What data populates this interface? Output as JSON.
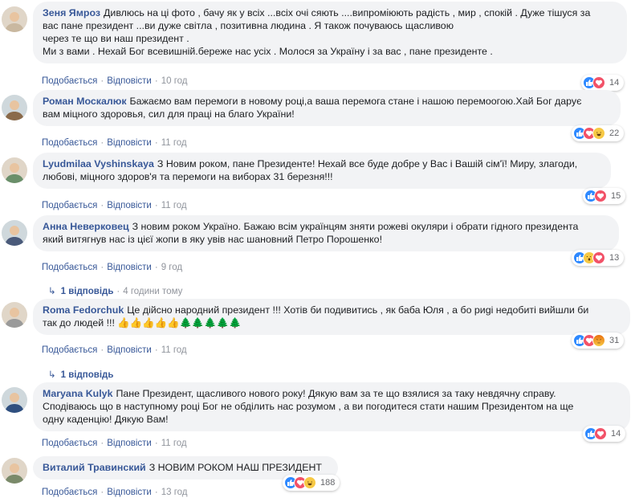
{
  "actions": {
    "like": "Подобається",
    "reply": "Відповісти",
    "separator": "·"
  },
  "comments": [
    {
      "author": "Зеня Ямроз",
      "lines": [
        "Дивлюсь на ці фото , бачу як у всіх ...всіх очі сяють ....випромiюють радість , мир , спокій . Дуже тішуся за",
        "вас пане президент ...ви дуже світла , позитивна людина . Я також почуваюсь щасливою",
        "через те що ви наш президент .",
        "Ми з вами . Нехай Бог всевишній.береже нас усіх . Молося за Україну і за вас , пане президенте ."
      ],
      "time": "10 год",
      "reactions": [
        "like",
        "love"
      ],
      "reaction_count": "14",
      "avatar_color": "#c9b8a0"
    },
    {
      "author": "Роман Москалюк",
      "lines": [
        "Бажаємо вам перемоги в новому році,а ваша перемога стане і нашою перемоогою.Хай Бог дарує",
        "вам міцного здоровья, сил для праці на благо України!"
      ],
      "time": "11 год",
      "reactions": [
        "like",
        "love",
        "haha"
      ],
      "reaction_count": "22",
      "avatar_color": "#8a6a4a"
    },
    {
      "author": "Lyudmilaa Vyshinskaya",
      "lines": [
        "З Новим роком, пане Президенте! Нехай все буде добре у Вас і Вашій сім'ї! Миру, злагоди,",
        "любові, міцного здоров'я та перемоги на виборах 31 березня!!!"
      ],
      "time": "11 год",
      "reactions": [
        "like",
        "love"
      ],
      "reaction_count": "15",
      "avatar_color": "#6a8f6a"
    },
    {
      "author": "Анна Неверковец",
      "lines": [
        "З новим роком Україно. Бажаю всім українцям зняти рожеві окуляри і обрати гідного президента",
        "який витягнув нас із цієї жопи в яку увів нас шановний Петро Порошенко!"
      ],
      "time": "9 год",
      "reactions": [
        "like",
        "wow",
        "love"
      ],
      "reaction_count": "13",
      "avatar_color": "#4a5a7a",
      "replies": {
        "label": "1 відповідь",
        "time": "4 години тому"
      }
    },
    {
      "author": "Roma Fedorchuk",
      "lines": [
        "Це дійсно народний президент !!! Хотів би подивитись , як баба Юля , а бо риgі недобиті вийшли би",
        "так до людей !!! 👍👍👍👍👍🌲🌲🌲🌲🌲"
      ],
      "time": "11 год",
      "reactions": [
        "like",
        "love",
        "angry"
      ],
      "reaction_count": "31",
      "avatar_color": "#9a9a9a",
      "replies": {
        "label": "1 відповідь",
        "time": ""
      }
    },
    {
      "author": "Maryana Kulyk",
      "lines": [
        "Пане Президент, щасливого нового року! Дякую вам за те що взялися за таку невдячну справу.",
        "Сподіваюсь що в наступному році Бог не обділить нас розумом , а ви погодитеся стати нашим Президентом на ще",
        "одну каденцію! Дякую Вам!"
      ],
      "time": "11 год",
      "reactions": [
        "like",
        "love"
      ],
      "reaction_count": "14",
      "avatar_color": "#2f4f7f"
    },
    {
      "author": "Виталий Травинский",
      "lines": [
        "З НОВИМ РОКОМ НАШ ПРЕЗИДЕНТ"
      ],
      "time": "13 год",
      "reactions": [
        "like",
        "love",
        "haha"
      ],
      "reaction_count": "188",
      "avatar_color": "#7a8a6a"
    }
  ]
}
